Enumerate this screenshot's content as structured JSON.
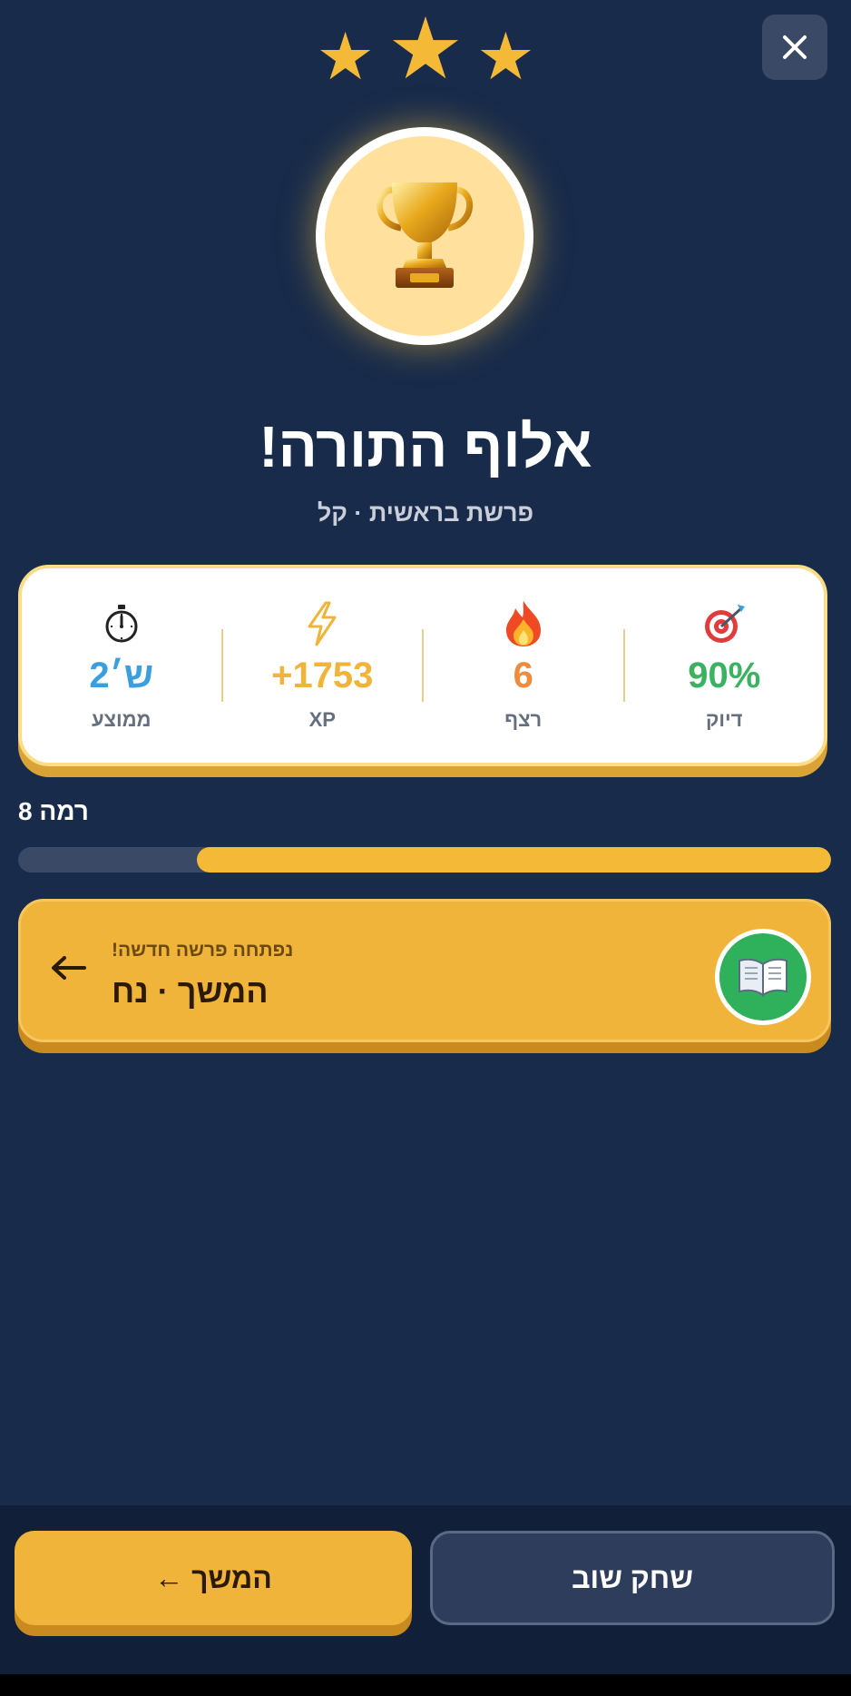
{
  "stars": {
    "earned": 3,
    "total": 3
  },
  "header": {
    "close_icon": "close-icon"
  },
  "hero": {
    "icon": "trophy-icon"
  },
  "result": {
    "title": "אלוף התורה!",
    "subtitle": "פרשת בראשית · קל"
  },
  "stats": [
    {
      "icon": "target-icon",
      "value": "90%",
      "label": "דיוק",
      "color": "#3ab25f"
    },
    {
      "icon": "fire-icon",
      "value": "6",
      "label": "רצף",
      "color": "#f08a3c"
    },
    {
      "icon": "lightning-icon",
      "value": "+1753",
      "label": "XP",
      "color": "#f0b43a"
    },
    {
      "icon": "stopwatch-icon",
      "value": "2ש׳",
      "label": "ממוצע",
      "color": "#3a9fdc"
    }
  ],
  "level": {
    "label": "רמה 8",
    "progress": 0.78,
    "track_color": "#3a4a66",
    "fill_color": "#f4b937"
  },
  "next_unlock": {
    "icon": "open-book-icon",
    "subtitle": "נפתחה פרשה חדשה!",
    "title": "המשך · נח",
    "arrow_icon": "arrow-left-icon"
  },
  "buttons": {
    "continue": "המשך ←",
    "replay": "שחק שוב"
  },
  "colors": {
    "background": "#182b4a",
    "accent": "#f4b937",
    "green": "#2fb05b"
  }
}
